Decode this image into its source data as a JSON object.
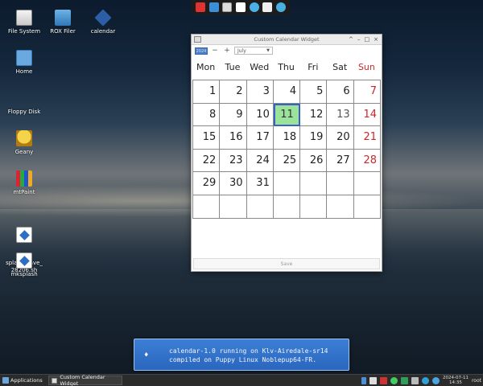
{
  "desktop": {
    "icons": [
      {
        "label": "File System",
        "icon": "drive-icon"
      },
      {
        "label": "ROX Filer",
        "icon": "folder-icon"
      },
      {
        "label": "calendar",
        "icon": "calendar-app-icon"
      },
      {
        "label": "Home",
        "icon": "home-folder-icon"
      },
      {
        "label": "Floppy Disk",
        "icon": "floppy-icon"
      },
      {
        "label": "Geany",
        "icon": "geany-icon"
      },
      {
        "label": "mtPaint",
        "icon": "mtpaint-icon"
      },
      {
        "label": "splash_save_\n28206.sh",
        "icon": "script-icon"
      },
      {
        "label": "mksplash",
        "icon": "script-icon"
      }
    ]
  },
  "window": {
    "title": "Custom Calendar Widget",
    "controls": {
      "collapse": "^",
      "minimize": "–",
      "maximize": "□",
      "close": "×"
    },
    "toolbar": {
      "year_label": "2024",
      "decrement": "−",
      "increment": "+",
      "month_selected": "July"
    },
    "weekdays": [
      "Mon",
      "Tue",
      "Wed",
      "Thu",
      "Fri",
      "Sat",
      "Sun"
    ],
    "weeks": [
      [
        "",
        "",
        "",
        "",
        "",
        "",
        ""
      ],
      [
        "",
        "",
        "",
        "",
        "",
        "",
        ""
      ],
      [
        "",
        "",
        "",
        "",
        "",
        "",
        ""
      ],
      [
        "",
        "",
        "",
        "",
        "",
        "",
        ""
      ],
      [
        "",
        "",
        "",
        "",
        "",
        "",
        ""
      ],
      [
        "",
        "",
        "",
        "",
        "",
        "",
        ""
      ]
    ],
    "days_row1": [
      "1",
      "2",
      "3",
      "4",
      "5",
      "6",
      "7"
    ],
    "days_row2": [
      "8",
      "9",
      "10",
      "11",
      "12",
      "13",
      "14"
    ],
    "days_row3": [
      "15",
      "16",
      "17",
      "18",
      "19",
      "20",
      "21"
    ],
    "days_row4": [
      "22",
      "23",
      "24",
      "25",
      "26",
      "27",
      "28"
    ],
    "days_row5": [
      "29",
      "30",
      "31",
      "",
      "",
      "",
      ""
    ],
    "days_row6": [
      "",
      "",
      "",
      "",
      "",
      "",
      ""
    ],
    "today": "11",
    "save_label": "Save"
  },
  "notification": {
    "line1": "calendar-1.0 running on Klv-Airedale-sr14",
    "line2": "compiled on Puppy Linux Noblepup64-FR."
  },
  "taskbar": {
    "applications_label": "Applications",
    "task_label": "Custom Calendar Widget",
    "clock_date": "2024-07-11",
    "clock_time": "14:35",
    "user": "root"
  },
  "colors": {
    "today_bg": "#9be39b",
    "today_border": "#3a62c4",
    "sunday": "#c8282b",
    "notify_bg": "#3472cc"
  }
}
